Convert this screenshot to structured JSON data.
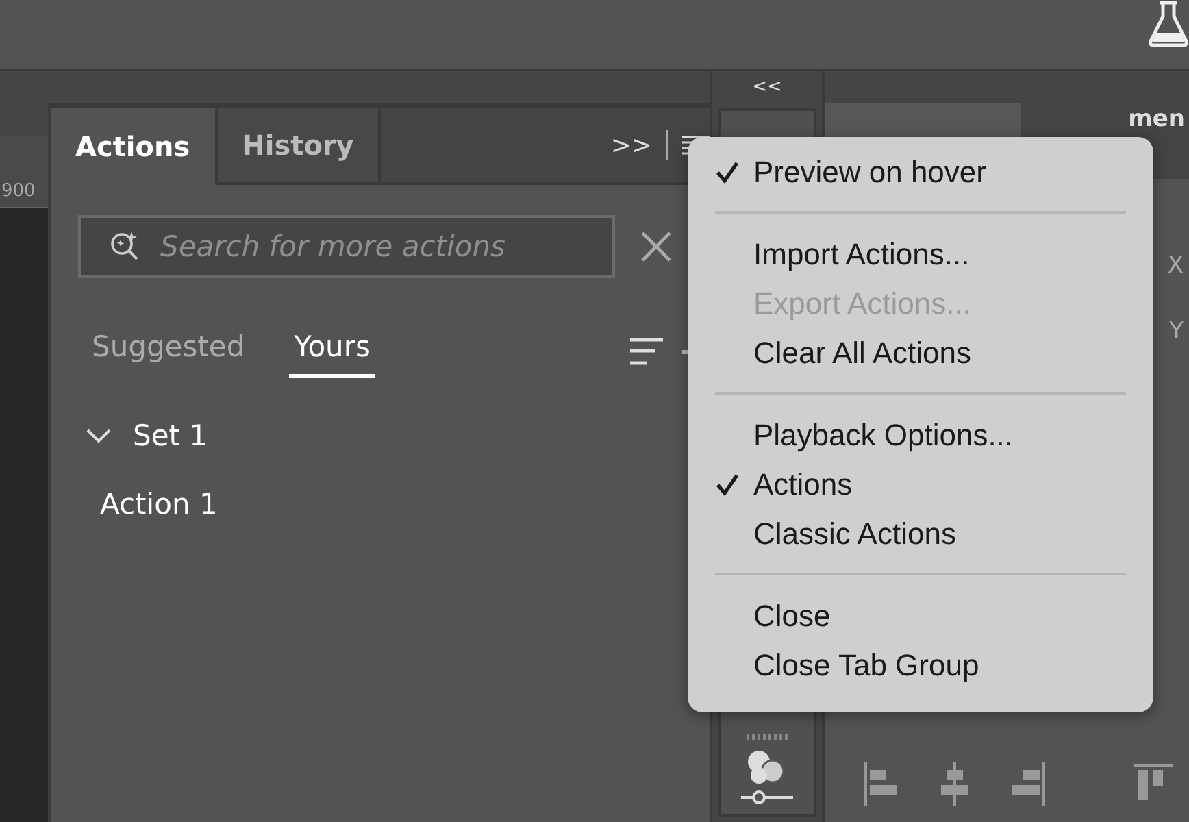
{
  "ruler": {
    "label": "900"
  },
  "panel": {
    "tabs": [
      {
        "label": "Actions",
        "selected": true
      },
      {
        "label": "History",
        "selected": false
      }
    ],
    "expand_label": ">>"
  },
  "search": {
    "placeholder": "Search for more actions"
  },
  "subtabs": [
    {
      "label": "Suggested",
      "selected": false
    },
    {
      "label": "Yours",
      "selected": true
    }
  ],
  "tree": [
    {
      "label": "Set 1",
      "expanded": true,
      "children": [
        {
          "label": "Action 1"
        }
      ]
    }
  ],
  "dock": {
    "collapse_label": "<<"
  },
  "right_panel": {
    "tab_fragment": "men",
    "field_labels": [
      "X",
      "Y"
    ]
  },
  "menu": {
    "sections": [
      [
        {
          "label": "Preview on hover",
          "checked": true,
          "disabled": false
        }
      ],
      [
        {
          "label": "Import Actions...",
          "checked": false,
          "disabled": false
        },
        {
          "label": "Export Actions...",
          "checked": false,
          "disabled": true
        },
        {
          "label": "Clear All Actions",
          "checked": false,
          "disabled": false
        }
      ],
      [
        {
          "label": "Playback Options...",
          "checked": false,
          "disabled": false
        },
        {
          "label": "Actions",
          "checked": true,
          "disabled": false
        },
        {
          "label": "Classic Actions",
          "checked": false,
          "disabled": false
        }
      ],
      [
        {
          "label": "Close",
          "checked": false,
          "disabled": false
        },
        {
          "label": "Close Tab Group",
          "checked": false,
          "disabled": false
        }
      ]
    ]
  }
}
